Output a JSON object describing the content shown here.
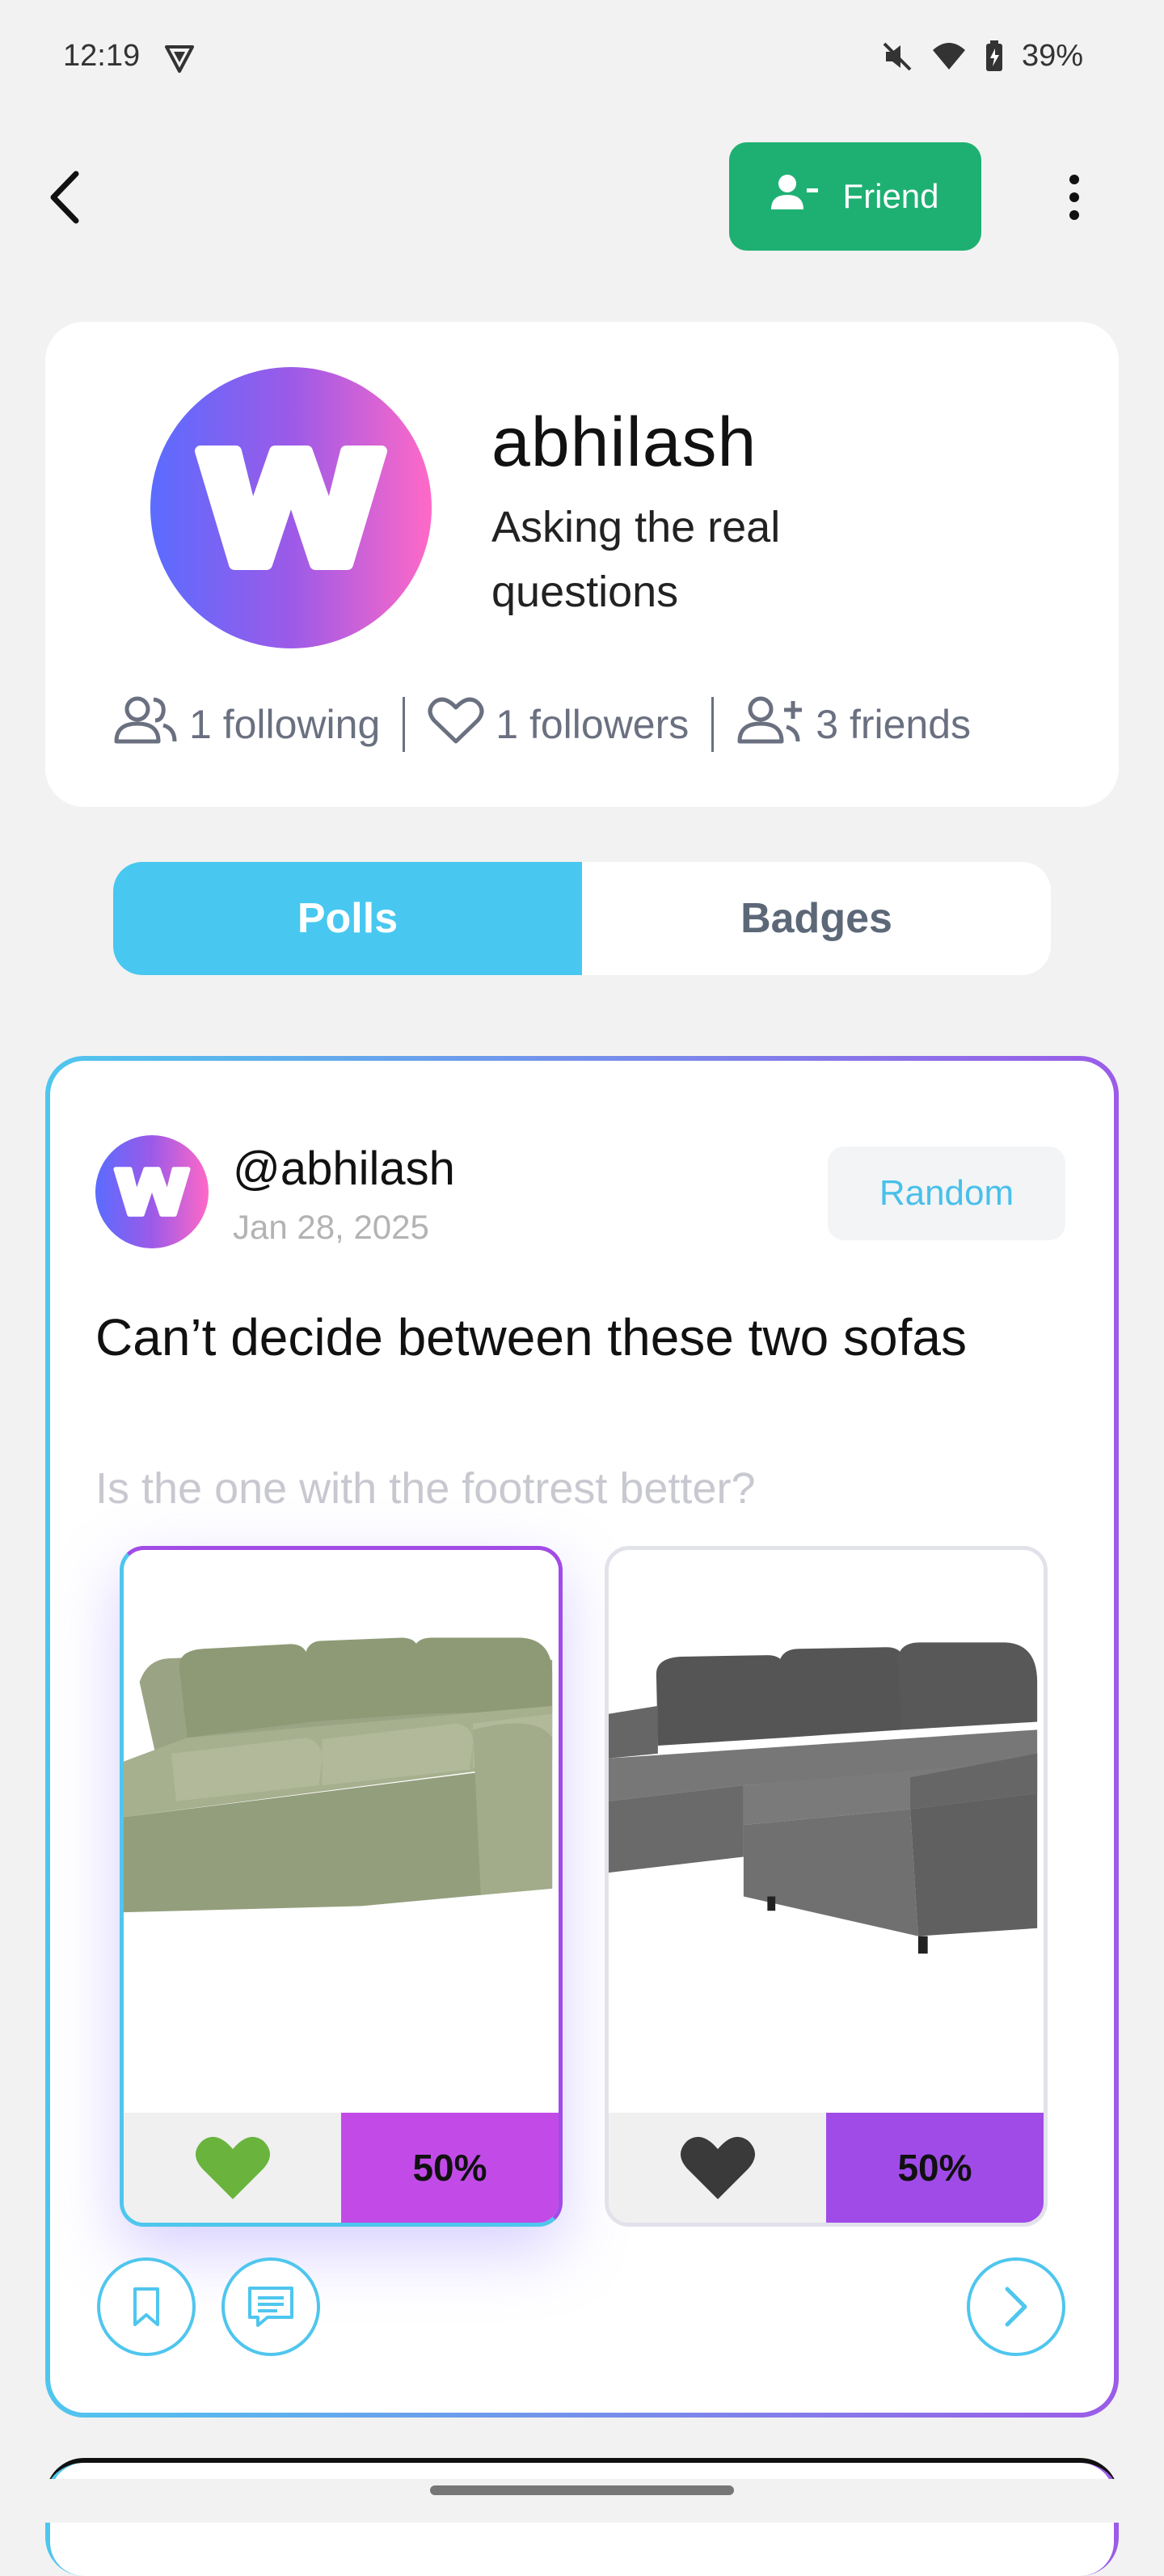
{
  "status_bar": {
    "time": "12:19",
    "battery": "39%"
  },
  "header": {
    "friend_label": "Friend"
  },
  "profile": {
    "avatar_letter": "W",
    "username": "abhilash",
    "bio": "Asking the real questions",
    "stats": {
      "following": "1 following",
      "followers": "1 followers",
      "friends": "3  friends"
    }
  },
  "tabs": [
    {
      "label": "Polls",
      "active": true
    },
    {
      "label": "Badges",
      "active": false
    }
  ],
  "poll": {
    "avatar_letter": "W",
    "handle": "@abhilash",
    "date": "Jan 28, 2025",
    "category": "Random",
    "title": "Can’t decide between these two sofas",
    "subtitle": "Is the one with the footrest better?",
    "options": [
      {
        "percent": "50%",
        "heart": "green-heart-icon"
      },
      {
        "percent": "50%",
        "heart": "black-heart-icon"
      }
    ]
  },
  "colors": {
    "friend_button": "#1eb073",
    "tab_active": "#48c8f0",
    "gradient_start": "#4fc6ee",
    "gradient_end": "#9b5ce8"
  }
}
